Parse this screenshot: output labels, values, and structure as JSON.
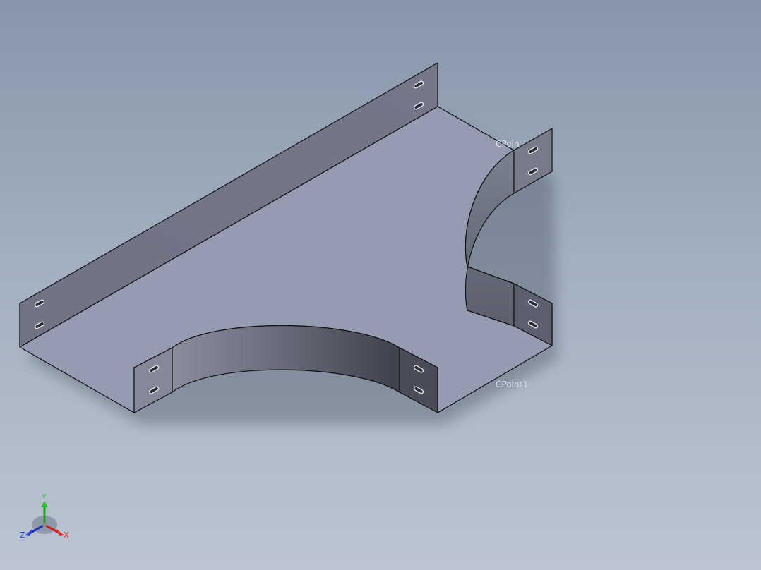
{
  "viewport": {
    "background_top": "#8796aa",
    "background_bottom": "#bcc5d1"
  },
  "model": {
    "type": "sheet-metal cable tray tee",
    "face_color": "#959bb0",
    "wall_color": "#6b6f80",
    "edge_color": "#111111"
  },
  "labels": {
    "cpoint_top": "CPoin",
    "cpoint_bottom": "CPoint1"
  },
  "triad": {
    "x_label": "X",
    "y_label": "Y",
    "z_label": "Z",
    "x_color": "#cc1f1f",
    "y_color": "#1fa01f",
    "z_color": "#1a2fbf"
  }
}
